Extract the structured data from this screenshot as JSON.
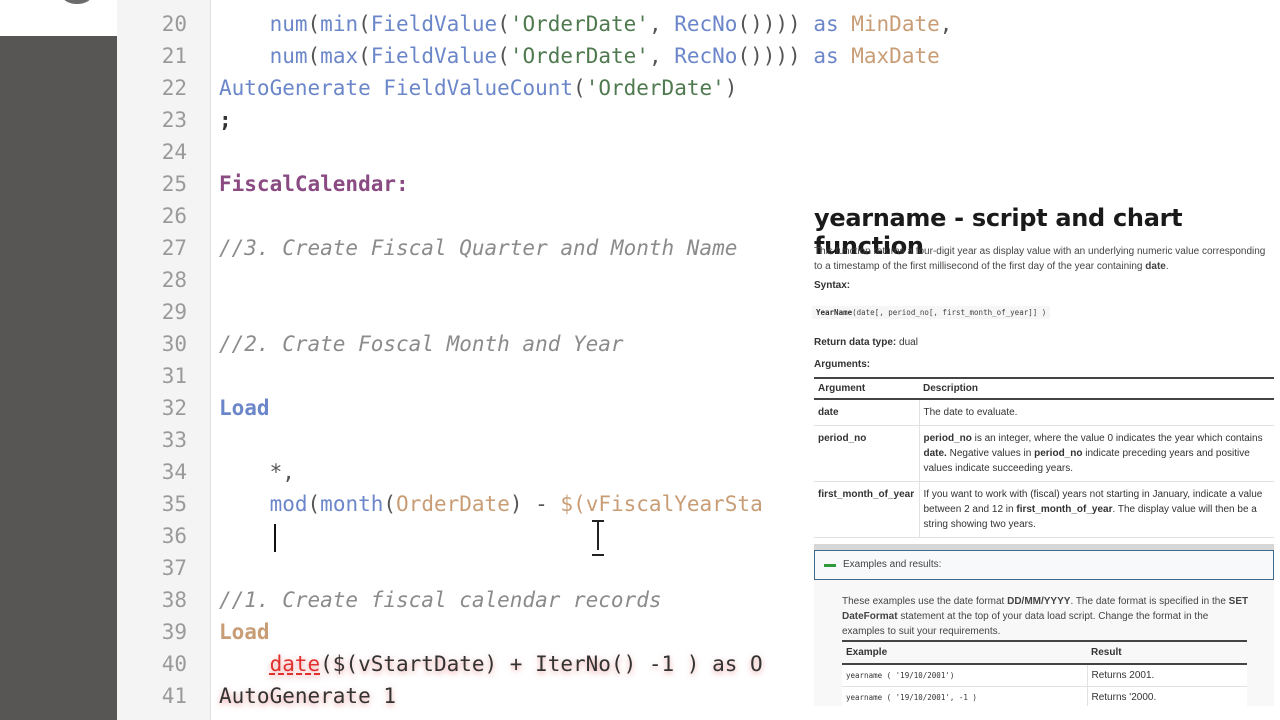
{
  "editor": {
    "line_numbers": [
      "20",
      "21",
      "22",
      "23",
      "24",
      "25",
      "26",
      "27",
      "28",
      "29",
      "30",
      "31",
      "32",
      "33",
      "34",
      "35",
      "36",
      "37",
      "38",
      "39",
      "40",
      "41"
    ],
    "lines": {
      "l20": {
        "a": "    ",
        "num": "num",
        "p1": "(",
        "min": "min",
        "p2": "(",
        "fv": "FieldValue",
        "p3": "(",
        "s": "'OrderDate'",
        "c": ", ",
        "rec": "RecNo",
        "p4": "())))",
        "as": " as ",
        "alias": "MinDate",
        "tail": ","
      },
      "l21": {
        "a": "    ",
        "num": "num",
        "p1": "(",
        "max": "max",
        "p2": "(",
        "fv": "FieldValue",
        "p3": "(",
        "s": "'OrderDate'",
        "c": ", ",
        "rec": "RecNo",
        "p4": "())))",
        "as": " as ",
        "alias": "MaxDate"
      },
      "l22": {
        "kw": "AutoGenerate",
        "sp": " ",
        "fn": "FieldValueCount",
        "p": "(",
        "s": "'OrderDate'",
        "p2": ")"
      },
      "l23": {
        "semi": ";"
      },
      "l25": {
        "label": "FiscalCalendar:"
      },
      "l27": {
        "cmt": "//3. Create Fiscal Quarter and Month Name"
      },
      "l30": {
        "cmt": "//2. Crate Foscal Month and Year"
      },
      "l32": {
        "kw": "Load"
      },
      "l34": {
        "a": "    ",
        "t": "*,"
      },
      "l35": {
        "a": "    ",
        "mod": "mod",
        "p1": "(",
        "month": "month",
        "p2": "(",
        "od": "OrderDate",
        "p3": ") - ",
        "var": "$(vFiscalYearSta"
      },
      "l38": {
        "cmt": "//1. Create fiscal calendar records"
      },
      "l39": {
        "kw": "Load"
      },
      "l40": {
        "a": "    ",
        "fn": "date",
        "rest": "($(vStartDate) + IterNo() -1 ) as O"
      },
      "l41": {
        "t": "AutoGenerate 1"
      }
    }
  },
  "help": {
    "title": "yearname - script and chart function",
    "description_pre": "This function returns a four-digit year as display value with an underlying numeric value corresponding to a timestamp of the first millisecond of the first day of the year containing ",
    "description_bold": "date",
    "description_post": ".",
    "syntax_label": "Syntax:",
    "syntax_fn": "YearName",
    "syntax_args": "(date[, period_no[, first_month_of_year]] )",
    "return_label": "Return data type:",
    "return_value": " dual",
    "arguments_label": "Arguments:",
    "args_headers": {
      "argument": "Argument",
      "description": "Description"
    },
    "args": [
      {
        "name": "date",
        "desc": "The date to evaluate."
      },
      {
        "name": "period_no",
        "desc": "period_no is an integer, where the value 0 indicates the year which contains date. Negative values in period_no indicate preceding years and positive values indicate succeeding years."
      },
      {
        "name": "first_month_of_year",
        "desc": "If you want to work with (fiscal) years not starting in January, indicate a value between 2 and 12 in first_month_of_year. The display value will then be a string showing two years."
      }
    ],
    "examples_toggle": "Examples and results:",
    "examples_text": "These examples use the date format DD/MM/YYYY. The date format is specified in the SET DateFormat statement at the top of your data load script. Change the format in the examples to suit your requirements.",
    "examples_headers": {
      "example": "Example",
      "result": "Result"
    },
    "examples": [
      {
        "example": "yearname ( '19/10/2001')",
        "result": "Returns 2001."
      },
      {
        "example": "yearname ( '19/10/2001', -1 )",
        "result": "Returns '2000."
      }
    ]
  }
}
